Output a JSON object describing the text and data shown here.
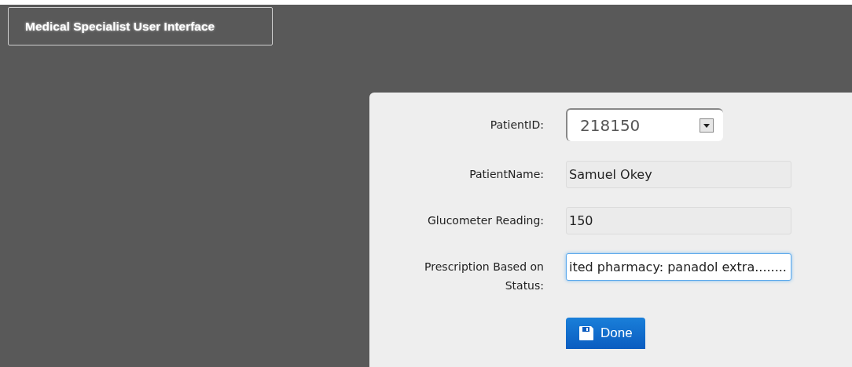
{
  "header": {
    "title": "Medical Specialist User Interface"
  },
  "form": {
    "fields": [
      {
        "label": "PatientID:",
        "kind": "select",
        "value": "218150",
        "focused": false
      },
      {
        "label": "PatientName:",
        "kind": "readonly",
        "value": "Samuel Okey",
        "focused": false
      },
      {
        "label": "Glucometer Reading:",
        "kind": "readonly",
        "value": "150",
        "focused": false
      },
      {
        "label": "Prescription Based on Status:",
        "kind": "text",
        "value": "ited pharmacy: panadol extra........",
        "focused": true
      }
    ],
    "submit": {
      "label": "Done"
    }
  }
}
